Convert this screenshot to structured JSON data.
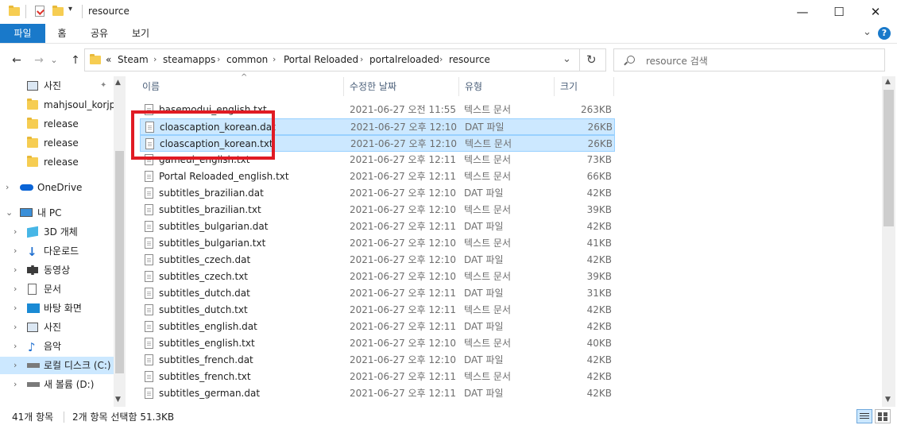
{
  "window": {
    "title": "resource",
    "minimize_glyph": "—",
    "maximize_glyph": "☐",
    "close_glyph": "✕"
  },
  "ribbon": {
    "tabs": [
      "파일",
      "홈",
      "공유",
      "보기"
    ],
    "expand_glyph": "⌄",
    "help_glyph": "?"
  },
  "nav": {
    "back_glyph": "←",
    "forward_glyph": "→",
    "recent_glyph": "⌄",
    "up_glyph": "↑",
    "overflow_glyph": "«",
    "breadcrumbs": [
      "Steam",
      "steamapps",
      "common",
      "Portal Reloaded",
      "portalreloaded",
      "resource"
    ],
    "sep_glyph": "›",
    "dropdown_glyph": "⌄",
    "refresh_glyph": "↻"
  },
  "search": {
    "placeholder": "resource 검색",
    "icon": "search-icon"
  },
  "navpane": {
    "quick_access": [
      {
        "label": "사진",
        "icon": "pictures-icon",
        "pinned": true
      },
      {
        "label": "mahjsoul_korjp",
        "icon": "folder-icon"
      },
      {
        "label": "release",
        "icon": "folder-icon"
      },
      {
        "label": "release",
        "icon": "folder-icon"
      },
      {
        "label": "release",
        "icon": "folder-icon"
      }
    ],
    "onedrive": "OneDrive",
    "this_pc": "내 PC",
    "pc_items": [
      {
        "label": "3D 개체",
        "icon": "cube-icon"
      },
      {
        "label": "다운로드",
        "icon": "download-icon"
      },
      {
        "label": "동영상",
        "icon": "video-icon"
      },
      {
        "label": "문서",
        "icon": "document-icon"
      },
      {
        "label": "바탕 화면",
        "icon": "desktop-icon"
      },
      {
        "label": "사진",
        "icon": "pictures-icon"
      },
      {
        "label": "음악",
        "icon": "music-icon"
      },
      {
        "label": "로컬 디스크 (C:)",
        "icon": "drive-icon"
      },
      {
        "label": "새 볼륨 (D:)",
        "icon": "drive-icon"
      }
    ],
    "chevron_right": "›",
    "chevron_down": "⌄",
    "pin_glyph": "📌"
  },
  "columns": {
    "name": "이름",
    "date": "수정한 날짜",
    "type": "유형",
    "size": "크기",
    "sort_glyph": "^"
  },
  "files": [
    {
      "name": "basemodui_english.txt",
      "date": "2021-06-27 오전 11:55",
      "type": "텍스트 문서",
      "size": "263KB"
    },
    {
      "name": "cloascaption_korean.dat",
      "date": "2021-06-27 오후 12:10",
      "type": "DAT 파일",
      "size": "26KB"
    },
    {
      "name": "cloascaption_korean.txt",
      "date": "2021-06-27 오후 12:10",
      "type": "텍스트 문서",
      "size": "26KB"
    },
    {
      "name": "gameui_english.txt",
      "date": "2021-06-27 오후 12:11",
      "type": "텍스트 문서",
      "size": "73KB"
    },
    {
      "name": "Portal Reloaded_english.txt",
      "date": "2021-06-27 오후 12:11",
      "type": "텍스트 문서",
      "size": "66KB"
    },
    {
      "name": "subtitles_brazilian.dat",
      "date": "2021-06-27 오후 12:10",
      "type": "DAT 파일",
      "size": "42KB"
    },
    {
      "name": "subtitles_brazilian.txt",
      "date": "2021-06-27 오후 12:10",
      "type": "텍스트 문서",
      "size": "39KB"
    },
    {
      "name": "subtitles_bulgarian.dat",
      "date": "2021-06-27 오후 12:11",
      "type": "DAT 파일",
      "size": "42KB"
    },
    {
      "name": "subtitles_bulgarian.txt",
      "date": "2021-06-27 오후 12:10",
      "type": "텍스트 문서",
      "size": "41KB"
    },
    {
      "name": "subtitles_czech.dat",
      "date": "2021-06-27 오후 12:10",
      "type": "DAT 파일",
      "size": "42KB"
    },
    {
      "name": "subtitles_czech.txt",
      "date": "2021-06-27 오후 12:10",
      "type": "텍스트 문서",
      "size": "39KB"
    },
    {
      "name": "subtitles_dutch.dat",
      "date": "2021-06-27 오후 12:11",
      "type": "DAT 파일",
      "size": "31KB"
    },
    {
      "name": "subtitles_dutch.txt",
      "date": "2021-06-27 오후 12:11",
      "type": "텍스트 문서",
      "size": "42KB"
    },
    {
      "name": "subtitles_english.dat",
      "date": "2021-06-27 오후 12:11",
      "type": "DAT 파일",
      "size": "42KB"
    },
    {
      "name": "subtitles_english.txt",
      "date": "2021-06-27 오후 12:10",
      "type": "텍스트 문서",
      "size": "40KB"
    },
    {
      "name": "subtitles_french.dat",
      "date": "2021-06-27 오후 12:10",
      "type": "DAT 파일",
      "size": "42KB"
    },
    {
      "name": "subtitles_french.txt",
      "date": "2021-06-27 오후 12:11",
      "type": "텍스트 문서",
      "size": "42KB"
    },
    {
      "name": "subtitles_german.dat",
      "date": "2021-06-27 오후 12:11",
      "type": "DAT 파일",
      "size": "42KB"
    }
  ],
  "status": {
    "count": "41개 항목",
    "selection": "2개 항목 선택함 51.3KB"
  },
  "colors": {
    "accent": "#1979ca",
    "selection": "#cce8ff",
    "highlight_box": "#e01b24"
  }
}
